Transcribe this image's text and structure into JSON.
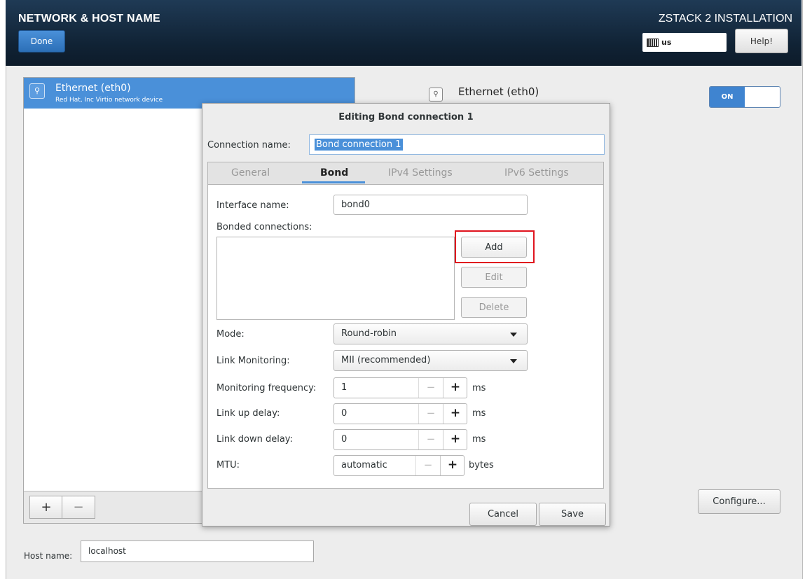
{
  "header": {
    "title": "NETWORK & HOST NAME",
    "done_label": "Done",
    "product": "ZSTACK 2 INSTALLATION",
    "keyboard_layout": "us",
    "help_label": "Help!"
  },
  "devices": {
    "items": [
      {
        "name": "Ethernet (eth0)",
        "description": "Red Hat, Inc Virtio network device"
      }
    ],
    "add_label": "+",
    "remove_label": "−"
  },
  "detail": {
    "title": "Ethernet (eth0)",
    "toggle_label": "ON",
    "configure_label": "Configure..."
  },
  "hostname": {
    "label": "Host name:",
    "value": "localhost"
  },
  "dialog": {
    "title": "Editing Bond connection 1",
    "connection_name_label": "Connection name:",
    "connection_name_value": "Bond connection 1",
    "tabs": [
      "General",
      "Bond",
      "IPv4 Settings",
      "IPv6 Settings"
    ],
    "active_tab": "Bond",
    "interface_name_label": "Interface name:",
    "interface_name_value": "bond0",
    "bonded_label": "Bonded connections:",
    "add_label": "Add",
    "edit_label": "Edit",
    "delete_label": "Delete",
    "mode_label": "Mode:",
    "mode_value": "Round-robin",
    "link_monitoring_label": "Link Monitoring:",
    "link_monitoring_value": "MII (recommended)",
    "monitoring_frequency_label": "Monitoring frequency:",
    "monitoring_frequency_value": "1",
    "link_up_delay_label": "Link up delay:",
    "link_up_delay_value": "0",
    "link_down_delay_label": "Link down delay:",
    "link_down_delay_value": "0",
    "mtu_label": "MTU:",
    "mtu_value": "automatic",
    "ms_unit": "ms",
    "bytes_unit": "bytes",
    "minus": "−",
    "plus": "+",
    "cancel_label": "Cancel",
    "save_label": "Save"
  },
  "colors": {
    "accent": "#4a90d9",
    "highlight": "#e0141e",
    "header_bg": "#102234"
  }
}
